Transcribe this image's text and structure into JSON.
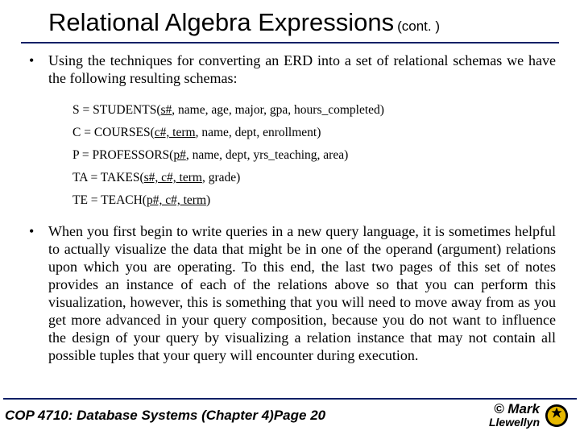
{
  "title": "Relational Algebra Expressions",
  "title_suffix": " (cont. )",
  "bullets": [
    "Using the techniques for converting an ERD into a set of relational schemas we have the following resulting schemas:",
    "When you first begin to write queries in a new query language, it is sometimes helpful to actually visualize the data that might be in one of the operand (argument) relations upon which you are operating.  To this end, the last two pages of this set of notes provides an instance of each of the relations above so that you can perform this visualization, however, this is something that you will need to move away from as you get more advanced in your query composition, because you do not want to influence the design of your query by visualizing a relation instance that may not contain all possible tuples that your query will encounter during execution."
  ],
  "schemas": {
    "s": {
      "lhs": "S = STUDENTS(",
      "keys": "s#",
      "rest": ", name, age, major, gpa, hours_completed)"
    },
    "c": {
      "lhs": "C = COURSES(",
      "keys": "c#, term",
      "rest": ", name, dept, enrollment)"
    },
    "p": {
      "lhs": "P = PROFESSORS(",
      "keys": "p#",
      "rest": ", name, dept, yrs_teaching, area)"
    },
    "ta": {
      "lhs": "TA = TAKES(",
      "keys": "s#, c#, term",
      "rest": ", grade)"
    },
    "te": {
      "lhs": "TE = TEACH(",
      "keys": "p#, c#, term",
      "rest": ")"
    }
  },
  "footer": {
    "course": "COP 4710: Database Systems  (Chapter 4)",
    "page": "Page 20",
    "copyright": "© Mark",
    "author2": "Llewellyn"
  },
  "bullet_char": "•"
}
